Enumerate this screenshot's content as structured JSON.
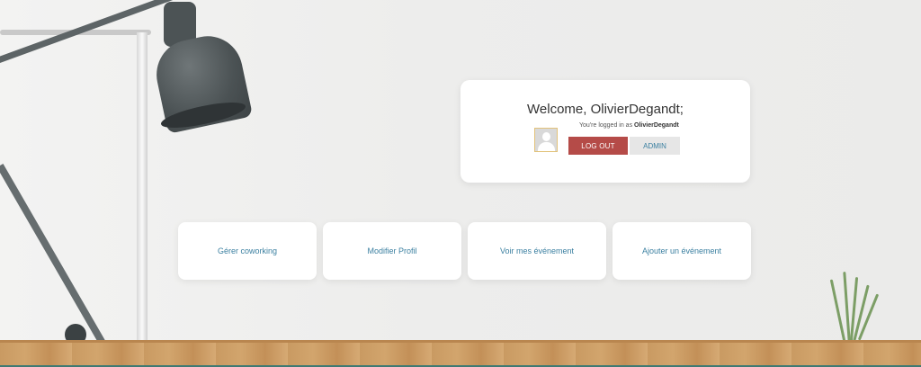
{
  "welcome": {
    "title": "Welcome, OlivierDegandt;",
    "logged_in_prefix": "You're logged in as",
    "username": "OlivierDegandt",
    "logout_label": "LOG OUT",
    "admin_label": "ADMIN"
  },
  "actions": [
    {
      "label": "Gérer coworking"
    },
    {
      "label": "Modifier Profil"
    },
    {
      "label": "Voir mes événement"
    },
    {
      "label": "Ajouter un événement"
    }
  ],
  "colors": {
    "logout": "#b54b48",
    "admin_bg": "#e6e6e6",
    "link": "#3a7fa0"
  }
}
